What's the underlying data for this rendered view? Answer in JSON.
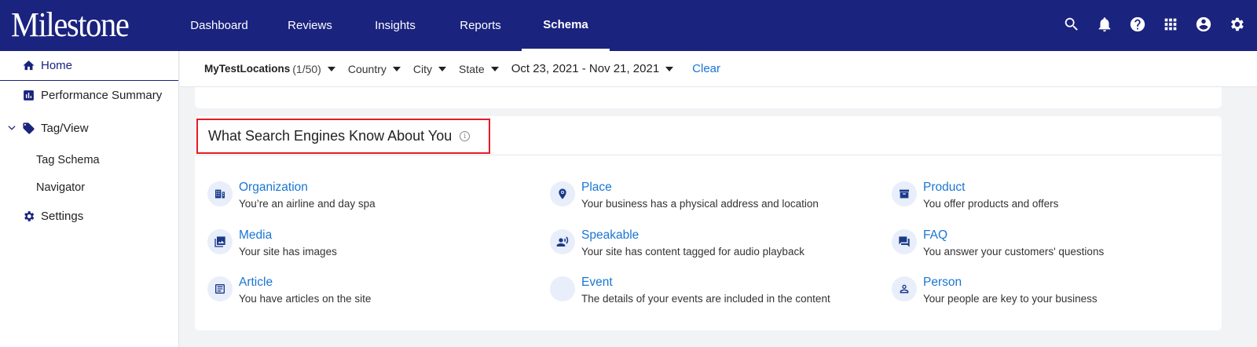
{
  "app": {
    "logo": "Milestone"
  },
  "nav": {
    "tabs": [
      {
        "label": "Dashboard"
      },
      {
        "label": "Reviews"
      },
      {
        "label": "Insights"
      },
      {
        "label": "Reports"
      },
      {
        "label": "Schema",
        "active": true
      }
    ],
    "icons": [
      "search-icon",
      "bell-icon",
      "help-icon",
      "apps-grid-icon",
      "account-icon",
      "settings-icon"
    ]
  },
  "sidebar": {
    "home": "Home",
    "performance_summary": "Performance Summary",
    "tag_view": "Tag/View",
    "tag_schema": "Tag Schema",
    "navigator": "Navigator",
    "settings": "Settings"
  },
  "filters": {
    "locations": "MyTestLocations",
    "locations_count": "(1/50)",
    "country": "Country",
    "city": "City",
    "state": "State",
    "date_range": "Oct 23, 2021 - Nov 21, 2021",
    "clear": "Clear"
  },
  "card": {
    "title": "What Search Engines Know About You",
    "info_icon": "i",
    "items": [
      {
        "title": "Organization",
        "desc": "You’re an airline and day spa",
        "icon": "building-icon"
      },
      {
        "title": "Place",
        "desc": "Your business has a physical address and location",
        "icon": "location-pin-icon"
      },
      {
        "title": "Product",
        "desc": "You offer products and offers",
        "icon": "archive-box-icon"
      },
      {
        "title": "Media",
        "desc": "Your site has images",
        "icon": "images-icon"
      },
      {
        "title": "Speakable",
        "desc": "Your site has content tagged for audio playback",
        "icon": "speaker-voice-icon"
      },
      {
        "title": "FAQ",
        "desc": "You answer your customers' questions",
        "icon": "chat-bubbles-icon"
      },
      {
        "title": "Article",
        "desc": "You have articles on the site",
        "icon": "article-icon"
      },
      {
        "title": "Event",
        "desc": "The details of your events are included in the content",
        "icon": ""
      },
      {
        "title": "Person",
        "desc": "Your people are key to your business",
        "icon": "person-icon"
      }
    ]
  },
  "colors": {
    "topbar": "#1a237e",
    "link": "#1976d2",
    "highlight_box": "#e51b24"
  }
}
